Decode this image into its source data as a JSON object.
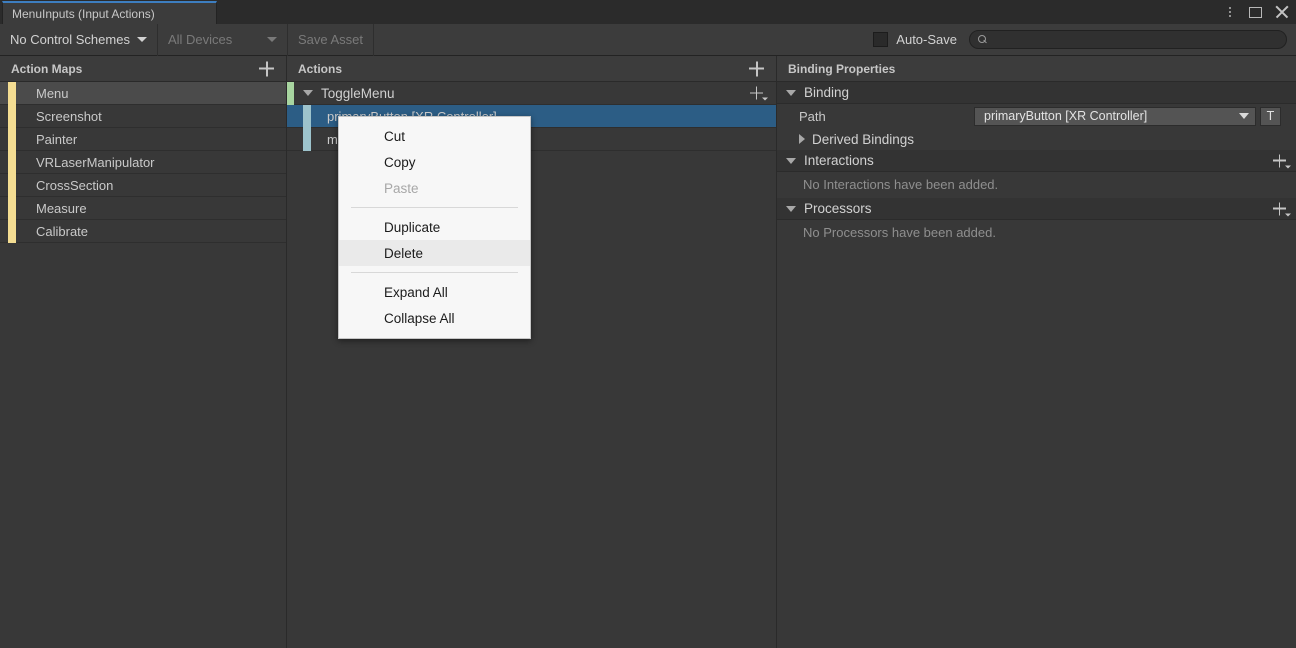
{
  "window": {
    "tab_label": "MenuInputs (Input Actions)",
    "accent_color": "#3d7ec0",
    "controls": {
      "kebab": "kebab-menu-icon",
      "maximize": "maximize-icon",
      "close": "close-icon"
    }
  },
  "toolbar": {
    "control_schemes_label": "No Control Schemes",
    "devices_label": "All Devices",
    "save_asset_label": "Save Asset",
    "autosave_label": "Auto-Save",
    "autosave_checked": false,
    "search_value": "",
    "search_placeholder": ""
  },
  "action_maps": {
    "header": "Action Maps",
    "add_label": "+",
    "bar_color": "#f4dd92",
    "items": [
      {
        "label": "Menu",
        "selected": true
      },
      {
        "label": "Screenshot",
        "selected": false
      },
      {
        "label": "Painter",
        "selected": false
      },
      {
        "label": "VRLaserManipulator",
        "selected": false
      },
      {
        "label": "CrossSection",
        "selected": false
      },
      {
        "label": "Measure",
        "selected": false
      },
      {
        "label": "Calibrate",
        "selected": false
      }
    ]
  },
  "actions": {
    "header": "Actions",
    "add_label": "+",
    "action_bar_color": "#a8d5a0",
    "binding_bar_color": "#9dc3cc",
    "tree": [
      {
        "label": "ToggleMenu",
        "expanded": true,
        "bindings": [
          {
            "label": "primaryButton [XR Controller]",
            "selected": true
          },
          {
            "label": "menuButton [XR Controller]",
            "selected": false
          }
        ]
      }
    ]
  },
  "binding_properties": {
    "header": "Binding Properties",
    "selection_color": "#2c5d85",
    "binding_section": {
      "title": "Binding",
      "expanded": true,
      "path_label": "Path",
      "path_value": "primaryButton [XR Controller]",
      "t_button_label": "T",
      "derived_bindings_label": "Derived Bindings",
      "derived_expanded": false
    },
    "interactions_section": {
      "title": "Interactions",
      "expanded": true,
      "empty_text": "No Interactions have been added.",
      "add_label": "+"
    },
    "processors_section": {
      "title": "Processors",
      "expanded": true,
      "empty_text": "No Processors have been added.",
      "add_label": "+"
    }
  },
  "context_menu": {
    "items": [
      {
        "label": "Cut",
        "disabled": false,
        "hovered": false,
        "separator_after": false
      },
      {
        "label": "Copy",
        "disabled": false,
        "hovered": false,
        "separator_after": false
      },
      {
        "label": "Paste",
        "disabled": true,
        "hovered": false,
        "separator_after": true
      },
      {
        "label": "Duplicate",
        "disabled": false,
        "hovered": false,
        "separator_after": false
      },
      {
        "label": "Delete",
        "disabled": false,
        "hovered": true,
        "separator_after": true
      },
      {
        "label": "Expand All",
        "disabled": false,
        "hovered": false,
        "separator_after": false
      },
      {
        "label": "Collapse All",
        "disabled": false,
        "hovered": false,
        "separator_after": false
      }
    ]
  }
}
